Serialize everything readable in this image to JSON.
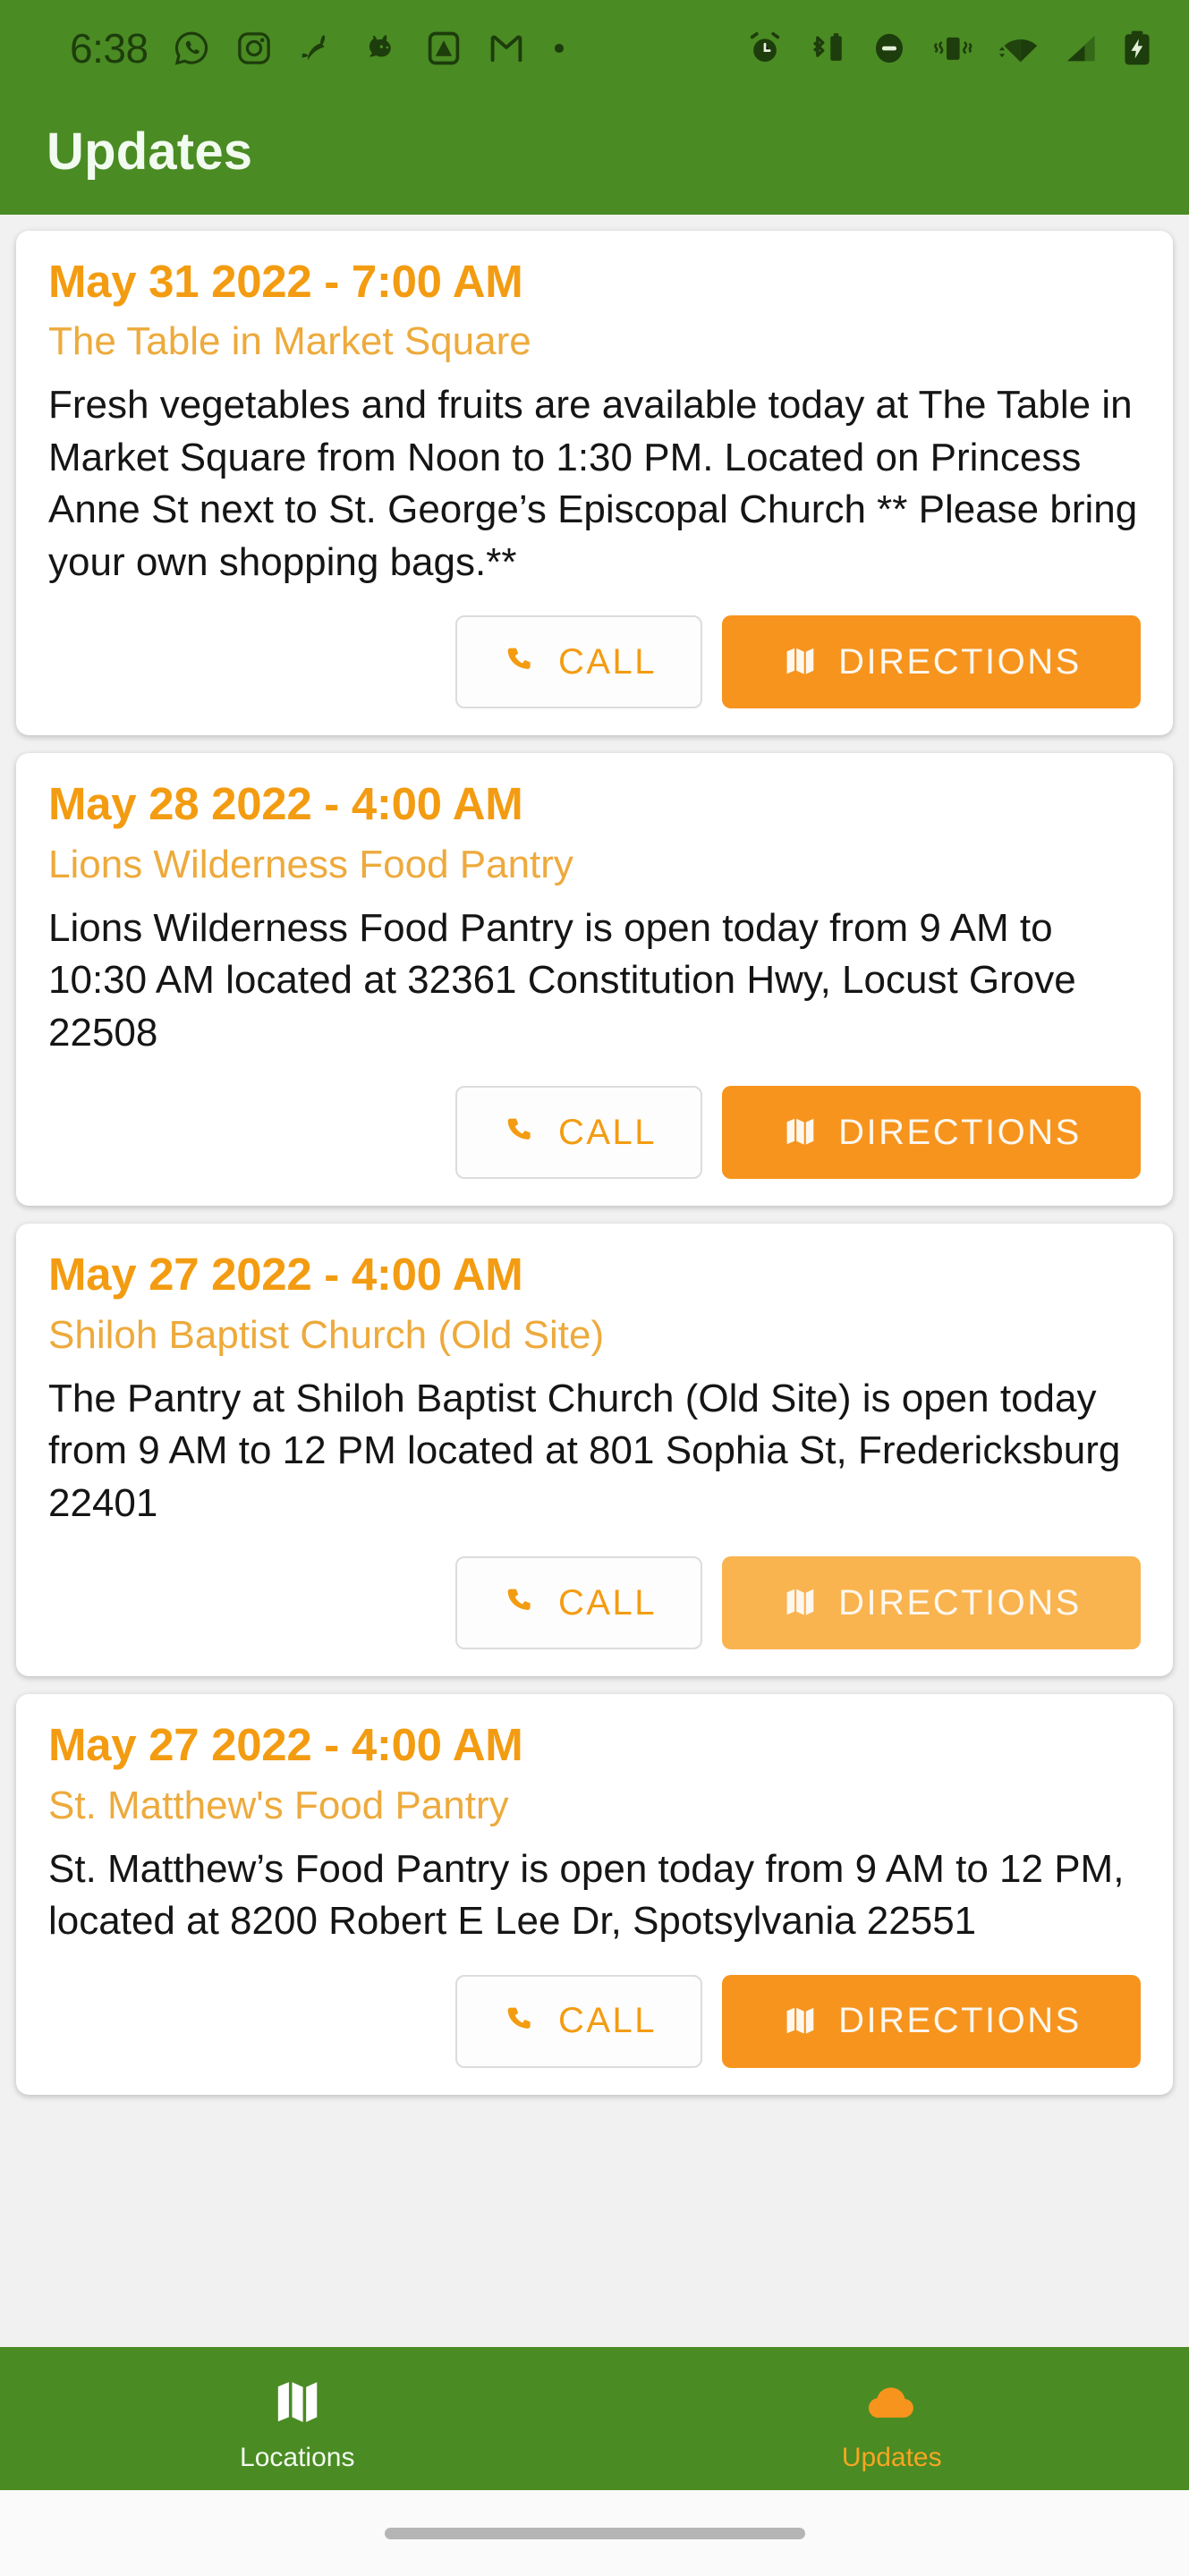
{
  "status_bar": {
    "clock": "6:38",
    "left_icons": [
      "whatsapp-icon",
      "instagram-icon",
      "rabbit-icon",
      "mouse-icon",
      "photos-icon",
      "gmail-icon",
      "dot-icon"
    ],
    "right_icons": [
      "alarm-icon",
      "bluetooth-battery-icon",
      "do-not-disturb-icon",
      "vibrate-icon",
      "wifi-icon",
      "cellular-signal-icon",
      "battery-charging-icon"
    ],
    "background_color": "#4a8b23"
  },
  "app_bar": {
    "title": "Updates",
    "background_color": "#4a8b23",
    "text_color": "#f2fbf0"
  },
  "theme": {
    "accent_orange": "#f7941d",
    "date_orange": "#f39c12",
    "place_orange": "#edaa3c",
    "green": "#4a8b23",
    "page_background": "#f1f1f1",
    "card_background": "#ffffff"
  },
  "updates": [
    {
      "date": "May 31 2022 - 7:00 AM",
      "place": "The Table in Market Square",
      "body": "Fresh vegetables and fruits are available today at The Table in Market Square from Noon to 1:30 PM. Located on Princess Anne St next to St. George’s Episcopal Church ** Please bring your own shopping bags.**",
      "call_label": "CALL",
      "directions_label": "DIRECTIONS",
      "directions_pressed": false
    },
    {
      "date": "May 28 2022 - 4:00 AM",
      "place": "Lions Wilderness Food Pantry",
      "body": "Lions Wilderness Food Pantry is open today from 9 AM to 10:30 AM located at 32361 Constitution Hwy, Locust Grove 22508",
      "call_label": "CALL",
      "directions_label": "DIRECTIONS",
      "directions_pressed": false
    },
    {
      "date": "May 27 2022 - 4:00 AM",
      "place": "Shiloh Baptist Church (Old Site)",
      "body": "The Pantry at Shiloh Baptist Church (Old Site) is open today from 9 AM to 12 PM located at 801 Sophia St, Fredericksburg 22401",
      "call_label": "CALL",
      "directions_label": "DIRECTIONS",
      "directions_pressed": true
    },
    {
      "date": "May 27 2022 - 4:00 AM",
      "place": "St. Matthew's Food Pantry",
      "body": "St. Matthew’s Food Pantry is open today from 9 AM to 12 PM, located at 8200 Robert E Lee Dr, Spotsylvania 22551",
      "call_label": "CALL",
      "directions_label": "DIRECTIONS",
      "directions_pressed": false
    }
  ],
  "bottom_nav": {
    "items": [
      {
        "label": "Locations",
        "icon": "map-icon",
        "active": false
      },
      {
        "label": "Updates",
        "icon": "cloud-icon",
        "active": true
      }
    ]
  }
}
